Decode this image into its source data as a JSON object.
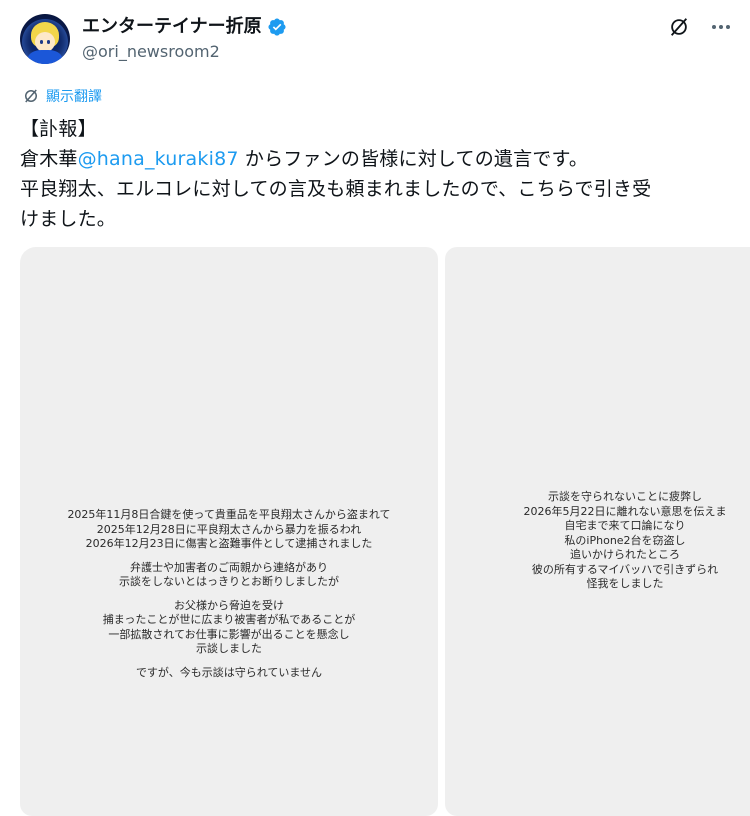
{
  "author": {
    "display_name": "エンターテイナー折原",
    "handle": "@ori_newsroom2",
    "verified": true
  },
  "icons": {
    "verified": "verified-badge-icon",
    "grok": "grok-icon",
    "more": "more-icon",
    "translate": "translate-icon"
  },
  "translate": {
    "label": "顯示翻譯"
  },
  "tweet": {
    "line1": "【訃報】",
    "line2_pre": "倉木華",
    "line2_mention": "@hana_kuraki87",
    "line2_post": " からファンの皆様に対しての遺言です。",
    "line3": "平良翔太、エルコレに対しての言及も頼まれましたので、こちらで引き受",
    "line4": "けました。"
  },
  "images": [
    {
      "paragraphs": [
        [
          "2025年11月8日合鍵を使って貴重品を平良翔太さんから盗まれて",
          "2025年12月28日に平良翔太さんから暴力を振るわれ",
          "2026年12月23日に傷害と盗難事件として逮捕されました"
        ],
        [
          "弁護士や加害者のご両親から連絡があり",
          "示談をしないとはっきりとお断りしましたが"
        ],
        [
          "お父様から脅迫を受け",
          "捕まったことが世に広まり被害者が私であることが",
          "一部拡散されてお仕事に影響が出ることを懸念し",
          "示談しました"
        ],
        [
          "ですが、今も示談は守られていません"
        ]
      ]
    },
    {
      "paragraphs": [
        [
          "示談を守られないことに疲弊し",
          "2026年5月22日に離れない意思を伝えま",
          "自宅まで来て口論になり",
          "私のiPhone2台を窃盗し",
          "追いかけられたところ",
          "彼の所有するマイバッハで引きずられ",
          "怪我をしました"
        ]
      ]
    }
  ],
  "colors": {
    "mention": "#1d9bf0",
    "verified": "#1d9bf0",
    "handle": "#536471",
    "image_bg": "#efefef"
  }
}
